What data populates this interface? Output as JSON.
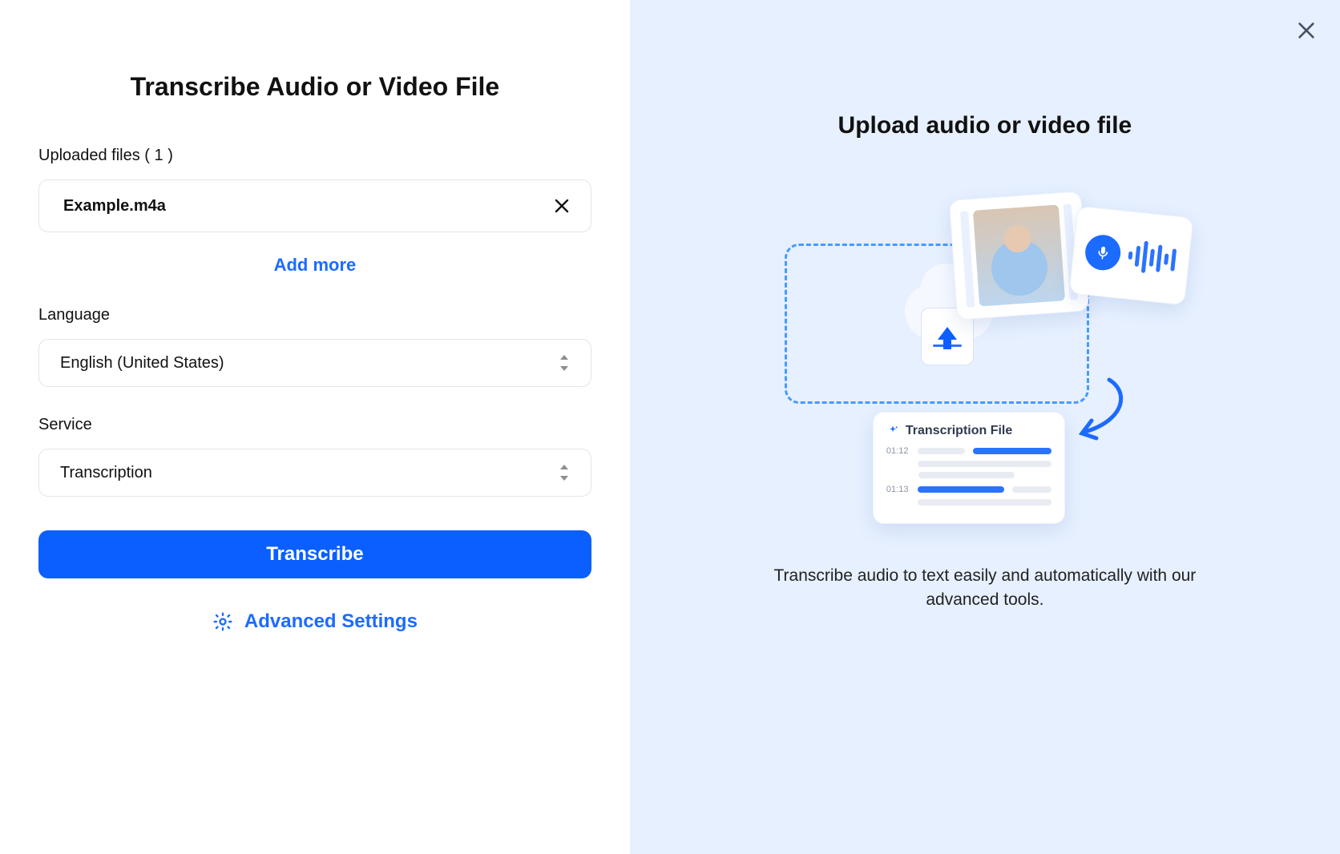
{
  "left": {
    "title": "Transcribe Audio or Video File",
    "uploaded_label": "Uploaded files ( 1 )",
    "file_name": "Example.m4a",
    "add_more": "Add more",
    "language_label": "Language",
    "language_value": "English (United States)",
    "service_label": "Service",
    "service_value": "Transcription",
    "transcribe_btn": "Transcribe",
    "advanced": "Advanced Settings"
  },
  "right": {
    "title": "Upload audio or video file",
    "caption": "Transcribe audio to text easily and automatically with our advanced tools.",
    "trans_card_title": "Transcription File",
    "ts1": "01:12",
    "ts2": "01:13"
  }
}
